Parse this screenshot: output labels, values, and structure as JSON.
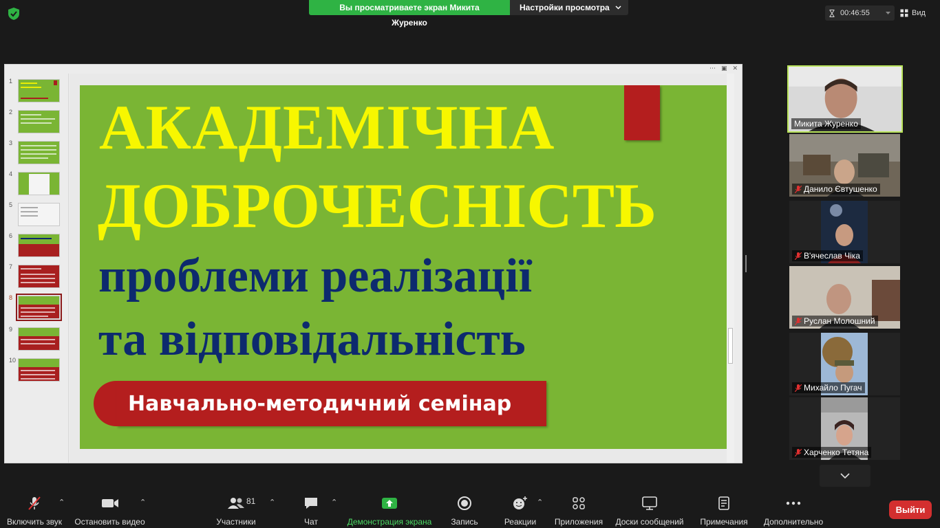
{
  "topbar": {
    "share_banner": "Вы просматриваете экран Микита Журенко",
    "view_settings": "Настройки просмотра",
    "timer": "00:46:55",
    "view": "Вид"
  },
  "slide": {
    "title_line1": "АКАДЕМІЧНА",
    "title_line2": "ДОБРОЧЕСНІСТЬ",
    "subtitle_line1": "проблеми реалізації",
    "subtitle_line2": "та відповідальність",
    "banner": "Навчально-методичний семінар"
  },
  "slide_thumbnails": {
    "numbers": [
      "1",
      "2",
      "3",
      "4",
      "5",
      "6",
      "7",
      "8",
      "9",
      "10"
    ],
    "active": 8
  },
  "participants": [
    {
      "name": "Микита Журенко",
      "muted": false,
      "active_speaker": true
    },
    {
      "name": "Данило Євтушенко",
      "muted": true
    },
    {
      "name": "В'ячеслав Чіка",
      "muted": true
    },
    {
      "name": "Руслан Молошний",
      "muted": true
    },
    {
      "name": "Михайло Пугач",
      "muted": true
    },
    {
      "name": "Харченко Тетяна",
      "muted": true
    }
  ],
  "toolbar": {
    "unmute": "Включить звук",
    "stop_video": "Остановить видео",
    "participants": "Участники",
    "participants_count": "81",
    "chat": "Чат",
    "share_screen": "Демонстрация экрана",
    "record": "Запись",
    "reactions": "Реакции",
    "apps": "Приложения",
    "whiteboards": "Доски сообщений",
    "notes": "Примечания",
    "more": "Дополнительно",
    "leave": "Выйти"
  },
  "colors": {
    "accent_green": "#2fb344",
    "slide_green": "#7ab534",
    "slide_yellow": "#f7f700",
    "slide_navy": "#0d2a6e",
    "slide_red": "#b41e1e",
    "leave_red": "#d32f2f",
    "active_speaker_border": "#b9e35a"
  }
}
